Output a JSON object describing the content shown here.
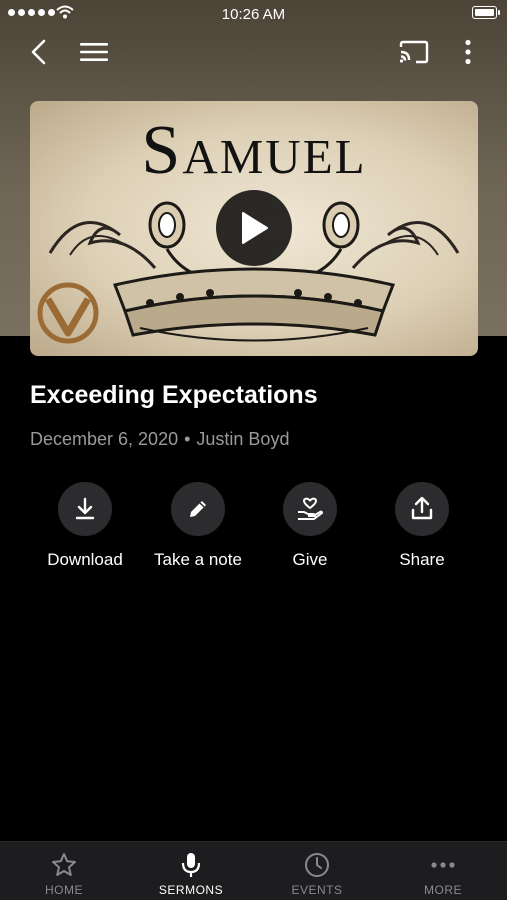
{
  "status_bar": {
    "time": "10:26 AM"
  },
  "nav": {
    "back": "back-icon",
    "menu": "menu-icon",
    "cast": "cast-icon",
    "more": "more-vertical-icon"
  },
  "artwork": {
    "title": "Samuel",
    "play_icon": "play-icon"
  },
  "sermon": {
    "title": "Exceeding Expectations",
    "date": "December 6, 2020",
    "separator": "•",
    "speaker": "Justin Boyd"
  },
  "actions": [
    {
      "label": "Download",
      "icon": "download-icon"
    },
    {
      "label": "Take a note",
      "icon": "pencil-icon"
    },
    {
      "label": "Give",
      "icon": "give-heart-hand-icon"
    },
    {
      "label": "Share",
      "icon": "share-icon"
    }
  ],
  "tabs": [
    {
      "label": "HOME",
      "icon": "star-icon",
      "active": false
    },
    {
      "label": "SERMONS",
      "icon": "microphone-icon",
      "active": true
    },
    {
      "label": "EVENTS",
      "icon": "clock-icon",
      "active": false
    },
    {
      "label": "MORE",
      "icon": "more-horizontal-icon",
      "active": false
    }
  ],
  "colors": {
    "background": "#000000",
    "hero": "#6e6555",
    "muted_text": "#9a9a9a",
    "tab_bar": "#1d1d1f",
    "action_circle": "#2c2c2e"
  }
}
